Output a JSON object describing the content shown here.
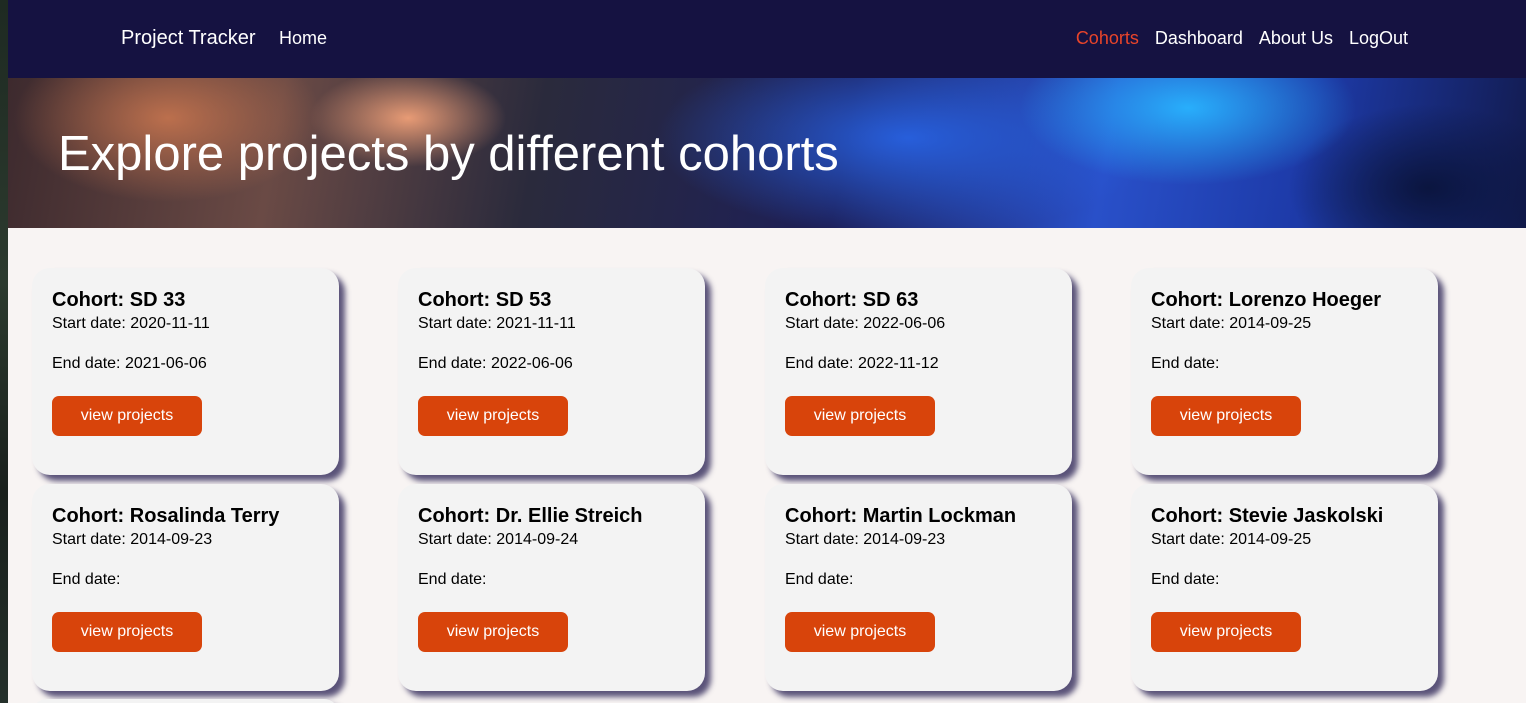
{
  "navbar": {
    "brand": "Project Tracker",
    "home": "Home",
    "links": [
      "Cohorts",
      "Dashboard",
      "About Us",
      "LogOut"
    ],
    "active_link": "Cohorts",
    "background": "#151241",
    "active_color": "#e8442a"
  },
  "hero": {
    "title": "Explore projects by different cohorts"
  },
  "cohorts": [
    {
      "title": "Cohort: SD 33",
      "start": "Start date: 2020-11-11",
      "end": "End date: 2021-06-06",
      "button": "view projects"
    },
    {
      "title": "Cohort: SD 53",
      "start": "Start date: 2021-11-11",
      "end": "End date: 2022-06-06",
      "button": "view projects"
    },
    {
      "title": "Cohort: SD 63",
      "start": "Start date: 2022-06-06",
      "end": "End date: 2022-11-12",
      "button": "view projects"
    },
    {
      "title": "Cohort: Lorenzo Hoeger",
      "start": "Start date: 2014-09-25",
      "end": "End date:",
      "button": "view projects"
    },
    {
      "title": "Cohort: Rosalinda Terry",
      "start": "Start date: 2014-09-23",
      "end": "End date:",
      "button": "view projects"
    },
    {
      "title": "Cohort: Dr. Ellie Streich",
      "start": "Start date: 2014-09-24",
      "end": "End date:",
      "button": "view projects"
    },
    {
      "title": "Cohort: Martin Lockman",
      "start": "Start date: 2014-09-23",
      "end": "End date:",
      "button": "view projects"
    },
    {
      "title": "Cohort: Stevie Jaskolski",
      "start": "Start date: 2014-09-25",
      "end": "End date:",
      "button": "view projects"
    }
  ],
  "colors": {
    "button": "#d8440b",
    "card": "#f3f3f3",
    "page": "#f8f4f3"
  }
}
